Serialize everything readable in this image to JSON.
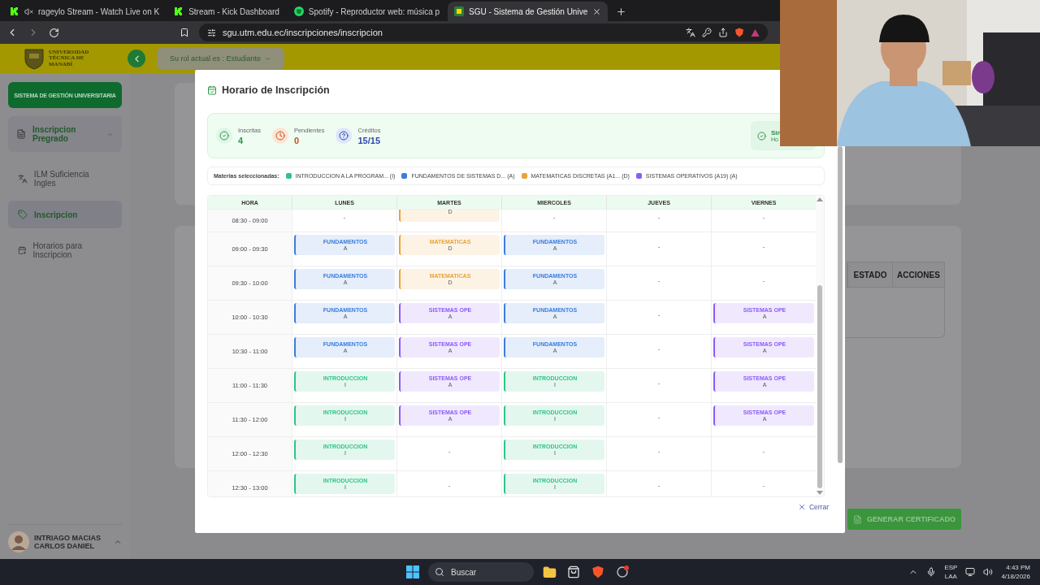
{
  "browser": {
    "tabs": [
      {
        "title": "rageylo Stream - Watch Live on K",
        "kind": "kick",
        "muted": true,
        "selected": false
      },
      {
        "title": "Stream - Kick Dashboard",
        "kind": "kick",
        "muted": false,
        "selected": false
      },
      {
        "title": "Spotify - Reproductor web: música p",
        "kind": "spotify",
        "muted": false,
        "selected": false
      },
      {
        "title": "SGU - Sistema de Gestión Unive",
        "kind": "site",
        "muted": false,
        "selected": true
      }
    ],
    "address": "sgu.utm.edu.ec/inscripciones/inscripcion"
  },
  "header": {
    "logo_lines": [
      "UNIVERSIDAD",
      "TÉCNICA DE",
      "MANABÍ"
    ],
    "role": "Su rol actual es : Estudiante"
  },
  "sidebar": {
    "brand": "SISTEMA DE GESTIÓN UNIVERSITARIA",
    "groups": [
      {
        "label": "Inscripcion Pregrado",
        "expanded": true,
        "children": [
          {
            "label": "ILM Suficiencia Ingles",
            "kind": "translate",
            "selected": false
          },
          {
            "label": "Inscripcion",
            "kind": "tag",
            "selected": true
          },
          {
            "label": "Horarios para Inscripcion",
            "kind": "calendar",
            "selected": false
          }
        ]
      }
    ],
    "user": {
      "name": "INTRIAGO MACIAS CARLOS DANIEL"
    }
  },
  "background": {
    "table_columns": [
      "ESTADO",
      "ACCIONES"
    ],
    "button": "GENERAR CERTIFICADO"
  },
  "modal": {
    "title": "Horario de Inscripción",
    "stats": [
      {
        "kind": "done",
        "label": "Inscritas",
        "value": "4"
      },
      {
        "kind": "pending",
        "label": "Pendientes",
        "value": "0"
      },
      {
        "kind": "credits",
        "label": "Créditos",
        "value": "15/15"
      }
    ],
    "status": {
      "title": "Sin",
      "subtitle": "Ho"
    },
    "legend": {
      "label": "Materias seleccionadas:",
      "items": [
        {
          "text": "INTRODUCCION A LA PROGRAM... (I)",
          "color": "#2fc486"
        },
        {
          "text": "FUNDAMENTOS DE SISTEMAS D... (A)",
          "color": "#3b7ddd"
        },
        {
          "text": "MATEMATICAS DISCRETAS (A1... (D)",
          "color": "#e9a23b"
        },
        {
          "text": "SISTEMAS OPERATIVOS (A19) (A)",
          "color": "#8b5cf6"
        }
      ]
    },
    "schedule": {
      "columns": [
        "HORA",
        "LUNES",
        "MARTES",
        "MIERCOLES",
        "JUEVES",
        "VIERNES"
      ],
      "rows": [
        {
          "cells": [
            {
              "kind": "time",
              "text": "08:30 - 09:00"
            },
            {
              "kind": "empty",
              "text": "-"
            },
            {
              "kind": "course",
              "group": "D",
              "color": "#e9a23b"
            },
            {
              "kind": "empty",
              "text": "-"
            },
            {
              "kind": "empty",
              "text": "-"
            },
            {
              "kind": "empty",
              "text": "-"
            }
          ]
        },
        {
          "cells": [
            {
              "kind": "time",
              "text": "09:00 - 09:30"
            },
            {
              "kind": "course",
              "name": "FUNDAMENTOS",
              "group": "A",
              "color": "#3b7ddd"
            },
            {
              "kind": "course",
              "name": "MATEMATICAS",
              "group": "D",
              "color": "#e9a23b"
            },
            {
              "kind": "course",
              "name": "FUNDAMENTOS",
              "group": "A",
              "color": "#3b7ddd"
            },
            {
              "kind": "empty",
              "text": "-"
            },
            {
              "kind": "empty",
              "text": "-"
            }
          ]
        },
        {
          "cells": [
            {
              "kind": "time",
              "text": "09:30 - 10:00"
            },
            {
              "kind": "course",
              "name": "FUNDAMENTOS",
              "group": "A",
              "color": "#3b7ddd"
            },
            {
              "kind": "course",
              "name": "MATEMATICAS",
              "group": "D",
              "color": "#e9a23b"
            },
            {
              "kind": "course",
              "name": "FUNDAMENTOS",
              "group": "A",
              "color": "#3b7ddd"
            },
            {
              "kind": "empty",
              "text": "-"
            },
            {
              "kind": "empty",
              "text": "-"
            }
          ]
        },
        {
          "cells": [
            {
              "kind": "time",
              "text": "10:00 - 10:30"
            },
            {
              "kind": "course",
              "name": "FUNDAMENTOS",
              "group": "A",
              "color": "#3b7ddd"
            },
            {
              "kind": "course",
              "name": "SISTEMAS OPE",
              "group": "A",
              "color": "#8b5cf6"
            },
            {
              "kind": "course",
              "name": "FUNDAMENTOS",
              "group": "A",
              "color": "#3b7ddd"
            },
            {
              "kind": "empty",
              "text": "-"
            },
            {
              "kind": "course",
              "name": "SISTEMAS OPE",
              "group": "A",
              "color": "#8b5cf6"
            }
          ]
        },
        {
          "cells": [
            {
              "kind": "time",
              "text": "10:30 - 11:00"
            },
            {
              "kind": "course",
              "name": "FUNDAMENTOS",
              "group": "A",
              "color": "#3b7ddd"
            },
            {
              "kind": "course",
              "name": "SISTEMAS OPE",
              "group": "A",
              "color": "#8b5cf6"
            },
            {
              "kind": "course",
              "name": "FUNDAMENTOS",
              "group": "A",
              "color": "#3b7ddd"
            },
            {
              "kind": "empty",
              "text": "-"
            },
            {
              "kind": "course",
              "name": "SISTEMAS OPE",
              "group": "A",
              "color": "#8b5cf6"
            }
          ]
        },
        {
          "cells": [
            {
              "kind": "time",
              "text": "11:00 - 11:30"
            },
            {
              "kind": "course",
              "name": "INTRODUCCION",
              "group": "I",
              "color": "#2fc486"
            },
            {
              "kind": "course",
              "name": "SISTEMAS OPE",
              "group": "A",
              "color": "#8b5cf6"
            },
            {
              "kind": "course",
              "name": "INTRODUCCION",
              "group": "I",
              "color": "#2fc486"
            },
            {
              "kind": "empty",
              "text": "-"
            },
            {
              "kind": "course",
              "name": "SISTEMAS OPE",
              "group": "A",
              "color": "#8b5cf6"
            }
          ]
        },
        {
          "cells": [
            {
              "kind": "time",
              "text": "11:30 - 12:00"
            },
            {
              "kind": "course",
              "name": "INTRODUCCION",
              "group": "I",
              "color": "#2fc486"
            },
            {
              "kind": "course",
              "name": "SISTEMAS OPE",
              "group": "A",
              "color": "#8b5cf6"
            },
            {
              "kind": "course",
              "name": "INTRODUCCION",
              "group": "I",
              "color": "#2fc486"
            },
            {
              "kind": "empty",
              "text": "-"
            },
            {
              "kind": "course",
              "name": "SISTEMAS OPE",
              "group": "A",
              "color": "#8b5cf6"
            }
          ]
        },
        {
          "cells": [
            {
              "kind": "time",
              "text": "12:00 - 12:30"
            },
            {
              "kind": "course",
              "name": "INTRODUCCION",
              "group": "I",
              "color": "#2fc486"
            },
            {
              "kind": "empty",
              "text": "-"
            },
            {
              "kind": "course",
              "name": "INTRODUCCION",
              "group": "I",
              "color": "#2fc486"
            },
            {
              "kind": "empty",
              "text": "-"
            },
            {
              "kind": "empty",
              "text": "-"
            }
          ]
        },
        {
          "cells": [
            {
              "kind": "time",
              "text": "12:30 - 13:00"
            },
            {
              "kind": "course",
              "name": "INTRODUCCION",
              "group": "I",
              "color": "#2fc486"
            },
            {
              "kind": "empty",
              "text": "-"
            },
            {
              "kind": "course",
              "name": "INTRODUCCION",
              "group": "I",
              "color": "#2fc486"
            },
            {
              "kind": "empty",
              "text": "-"
            },
            {
              "kind": "empty",
              "text": "-"
            }
          ]
        }
      ]
    },
    "close": "Cerrar"
  },
  "taskbar": {
    "search": "Buscar",
    "language": "ESP",
    "layout": "LAA",
    "time": "4:43 PM",
    "date": "4/18/2026"
  }
}
